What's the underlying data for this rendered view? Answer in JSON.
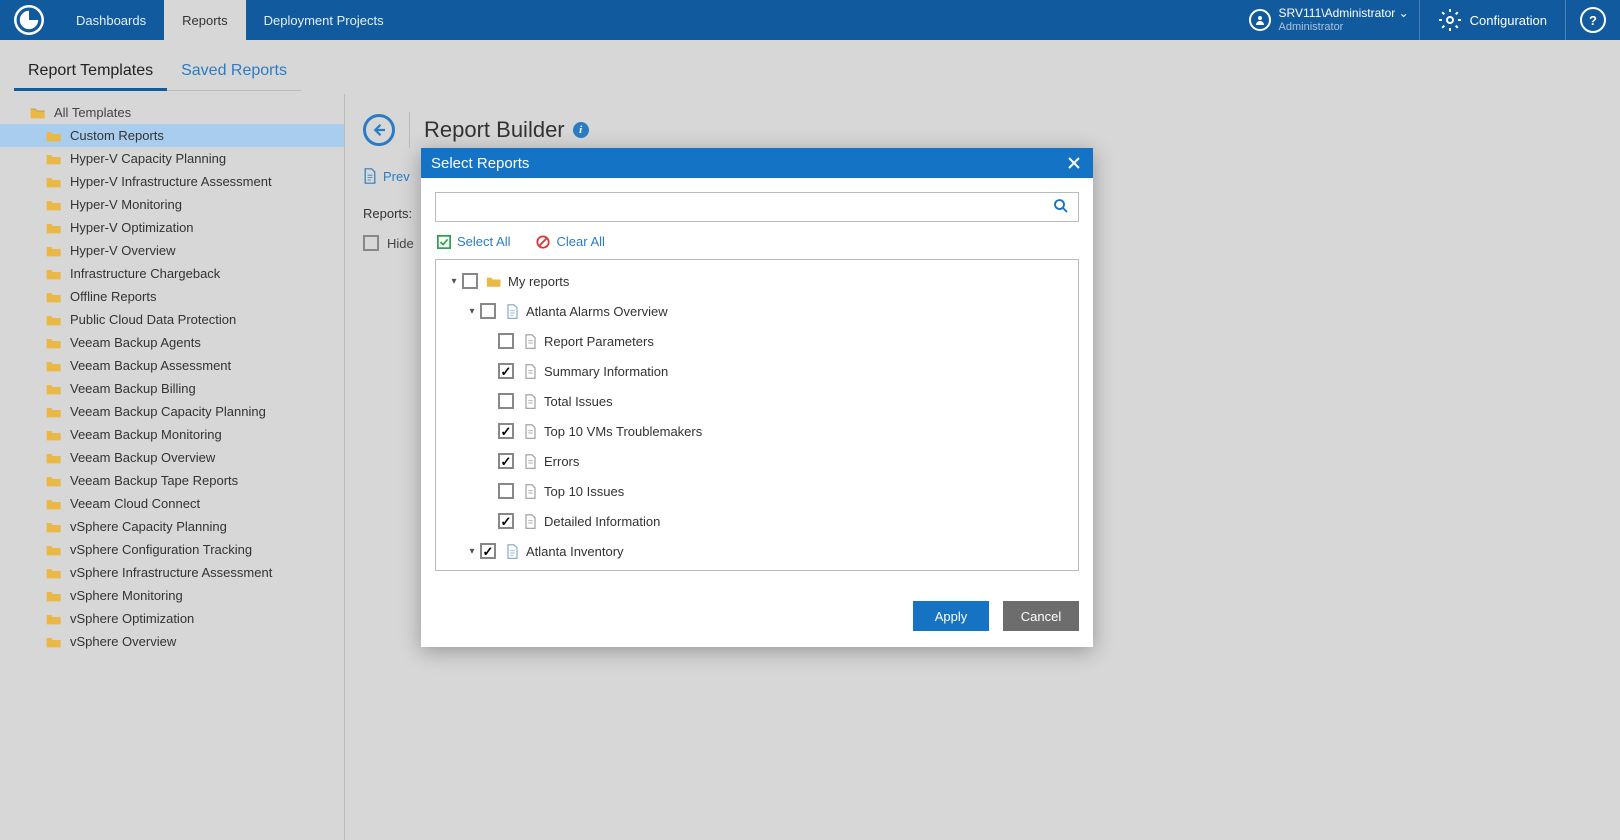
{
  "topnav": {
    "dashboards": "Dashboards",
    "reports": "Reports",
    "projects": "Deployment Projects"
  },
  "user": {
    "name": "SRV111\\Administrator",
    "role": "Administrator"
  },
  "config_label": "Configuration",
  "help_label": "?",
  "subtabs": {
    "templates": "Report Templates",
    "saved": "Saved Reports"
  },
  "tree": {
    "root": "All Templates",
    "items": [
      "Custom Reports",
      "Hyper-V Capacity Planning",
      "Hyper-V Infrastructure Assessment",
      "Hyper-V Monitoring",
      "Hyper-V Optimization",
      "Hyper-V Overview",
      "Infrastructure Chargeback",
      "Offline Reports",
      "Public Cloud Data Protection",
      "Veeam Backup Agents",
      "Veeam Backup Assessment",
      "Veeam Backup Billing",
      "Veeam Backup Capacity Planning",
      "Veeam Backup Monitoring",
      "Veeam Backup Overview",
      "Veeam Backup Tape Reports",
      "Veeam Cloud Connect",
      "vSphere Capacity Planning",
      "vSphere Configuration Tracking",
      "vSphere Infrastructure Assessment",
      "vSphere Monitoring",
      "vSphere Optimization",
      "vSphere Overview"
    ],
    "selected_index": 0
  },
  "main": {
    "title": "Report Builder",
    "preview_link": "Prev",
    "reports_label": "Reports:",
    "hide_label": "Hide"
  },
  "dialog": {
    "title": "Select Reports",
    "select_all": "Select All",
    "clear_all": "Clear All",
    "apply": "Apply",
    "cancel": "Cancel",
    "search_placeholder": "",
    "tree": [
      {
        "depth": 0,
        "exp": "v",
        "checked": false,
        "icon": "folder",
        "label": "My reports"
      },
      {
        "depth": 1,
        "exp": "v",
        "checked": false,
        "icon": "doc",
        "label": "Atlanta Alarms Overview"
      },
      {
        "depth": 2,
        "exp": "",
        "checked": false,
        "icon": "sec",
        "label": "Report Parameters"
      },
      {
        "depth": 2,
        "exp": "",
        "checked": true,
        "icon": "sec",
        "label": "Summary Information"
      },
      {
        "depth": 2,
        "exp": "",
        "checked": false,
        "icon": "sec",
        "label": "Total Issues"
      },
      {
        "depth": 2,
        "exp": "",
        "checked": true,
        "icon": "sec",
        "label": "Top 10 VMs Troublemakers"
      },
      {
        "depth": 2,
        "exp": "",
        "checked": true,
        "icon": "sec",
        "label": "Errors"
      },
      {
        "depth": 2,
        "exp": "",
        "checked": false,
        "icon": "sec",
        "label": "Top 10 Issues"
      },
      {
        "depth": 2,
        "exp": "",
        "checked": true,
        "icon": "sec",
        "label": "Detailed Information"
      },
      {
        "depth": 1,
        "exp": "v",
        "checked": true,
        "icon": "doc",
        "label": "Atlanta Inventory"
      }
    ]
  }
}
